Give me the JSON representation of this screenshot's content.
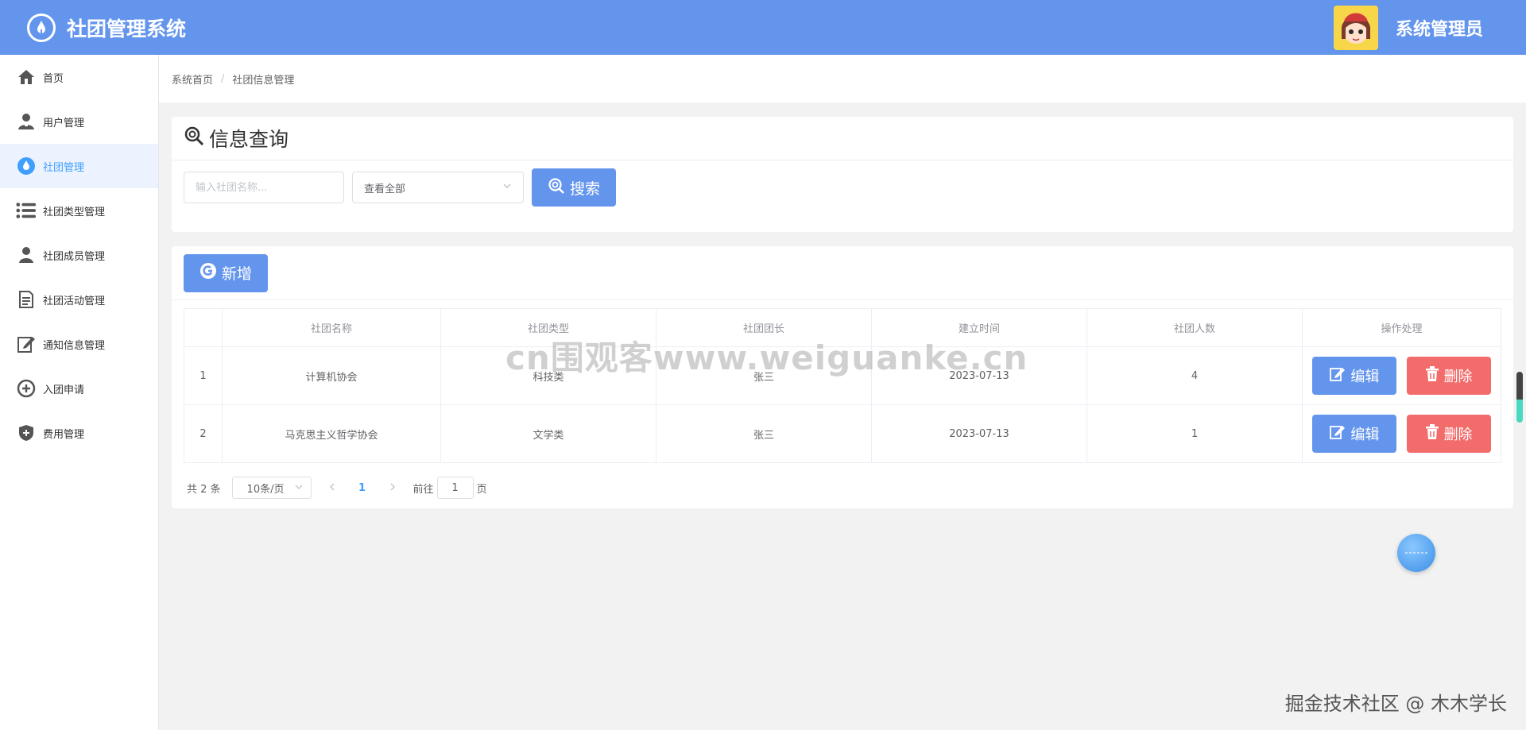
{
  "header": {
    "title": "社团管理系统",
    "user_name": "系统管理员"
  },
  "sidebar": {
    "items": [
      {
        "label": "首页",
        "icon": "home-icon"
      },
      {
        "label": "用户管理",
        "icon": "user-icon"
      },
      {
        "label": "社团管理",
        "icon": "drop-icon",
        "active": true
      },
      {
        "label": "社团类型管理",
        "icon": "list-icon"
      },
      {
        "label": "社团成员管理",
        "icon": "member-icon"
      },
      {
        "label": "社团活动管理",
        "icon": "document-icon"
      },
      {
        "label": "通知信息管理",
        "icon": "edit-icon"
      },
      {
        "label": "入团申请",
        "icon": "plus-circle-icon"
      },
      {
        "label": "费用管理",
        "icon": "shield-icon"
      }
    ]
  },
  "breadcrumb": {
    "home": "系统首页",
    "separator": "/",
    "current": "社团信息管理"
  },
  "search": {
    "title": "信息查询",
    "name_placeholder": "输入社团名称...",
    "type_selected": "查看全部",
    "search_label": "搜索"
  },
  "toolbar": {
    "add_label": "新增"
  },
  "table": {
    "headers": [
      "社团名称",
      "社团类型",
      "社团团长",
      "建立时间",
      "社团人数",
      "操作处理"
    ],
    "rows": [
      {
        "index": "1",
        "name": "计算机协会",
        "type": "科技类",
        "leader": "张三",
        "date": "2023-07-13",
        "count": "4"
      },
      {
        "index": "2",
        "name": "马克思主义哲学协会",
        "type": "文学类",
        "leader": "张三",
        "date": "2023-07-13",
        "count": "1"
      }
    ],
    "edit_label": "编辑",
    "delete_label": "删除"
  },
  "pagination": {
    "total_text": "共 2 条",
    "page_size": "10条/页",
    "current_page": "1",
    "goto_prefix": "前往",
    "goto_value": "1",
    "goto_suffix": "页"
  },
  "watermarks": {
    "center": "cn围观客www.weiguanke.cn",
    "bottom_right": "掘金技术社区 @ 木木学长"
  },
  "colors": {
    "header": "#6495ed",
    "primary_button": "#6495ed",
    "danger_button": "#f36c6c",
    "active_menu": "#409eff"
  }
}
